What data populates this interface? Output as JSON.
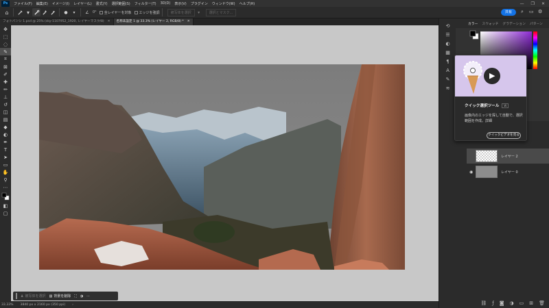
{
  "app": {
    "logo": "Ps"
  },
  "menubar": {
    "items": [
      "ファイル(F)",
      "編集(E)",
      "イメージ(I)",
      "レイヤー(L)",
      "書式(Y)",
      "選択範囲(S)",
      "フィルター(T)",
      "3D(D)",
      "表示(V)",
      "プラグイン",
      "ウィンドウ(W)",
      "ヘルプ(H)"
    ],
    "window_controls": [
      "—",
      "❐",
      "✕"
    ]
  },
  "options_bar": {
    "angle_value": "0°",
    "sample_all_layers_label": "全レイヤーを対象",
    "enhance_edge_label": "エッジを強調",
    "select_subject_label": "被写体を選択",
    "select_mask_label": "選択とマスク...",
    "share_label": "共有"
  },
  "tabs": [
    {
      "title": "フォトバンシ 1.psd @ 25% (sky-1107952_1920, レイヤーマスク/8)",
      "close": "✕",
      "active": false
    },
    {
      "title": "名称未設定 1 @ 33.3% (レイヤー 2, RGB/8) *",
      "close": "✕",
      "active": true
    }
  ],
  "status_bar": {
    "zoom": "33.33%",
    "doc_info": "3840 px x 2160 px (350 ppi)"
  },
  "context_bar": {
    "select_subject_label": "被写体を選択",
    "remove_bg_label": "背景を削除"
  },
  "right_panel": {
    "tabs": [
      "カラー",
      "スウォッチ",
      "グラデーション",
      "パターン"
    ],
    "layers": [
      {
        "name": "レイヤー 2",
        "visible_icon": "",
        "selected": true,
        "thumb": "checker"
      },
      {
        "name": "レイヤー 0",
        "visible_icon": "◉",
        "selected": false,
        "thumb": "gray"
      }
    ]
  },
  "tooltip": {
    "title": "クイック選択ツール",
    "badge": "W",
    "description": "画像内のエッジを探して自動で、選択範囲を作成。詳細",
    "button_label": "クイックビデオを見る"
  },
  "colors": {
    "accent": "#1473e6",
    "canvas_bg": "#c8c8c8",
    "sky": "#7e7e7e",
    "tooltip_media": "#d6c6ec"
  },
  "icons": {
    "home": "⌂",
    "quick_select": "✎",
    "play": "▶",
    "eye": "◉"
  }
}
